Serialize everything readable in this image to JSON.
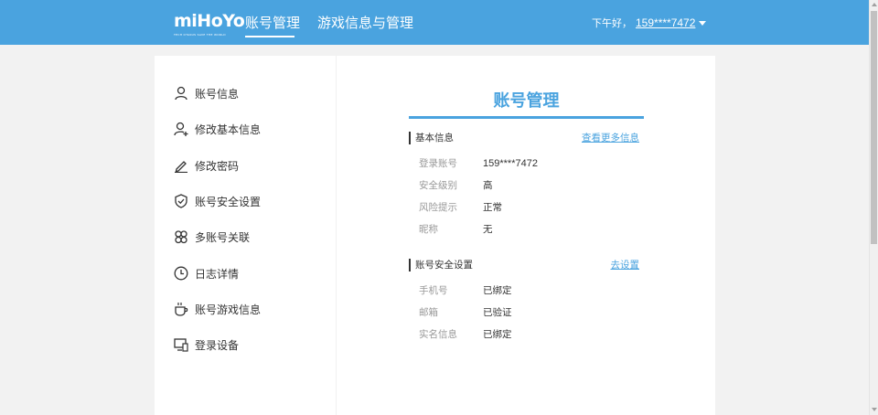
{
  "header": {
    "logo_text": "miHoYo",
    "logo_tagline": "TECH OTAKUS SAVE THE WORLD",
    "tabs": [
      {
        "label": "账号管理",
        "active": true
      },
      {
        "label": "游戏信息与管理",
        "active": false
      }
    ],
    "greeting": "下午好，",
    "username": "159****7472"
  },
  "sidebar": {
    "items": [
      {
        "label": "账号信息",
        "icon": "user-icon"
      },
      {
        "label": "修改基本信息",
        "icon": "user-edit-icon"
      },
      {
        "label": "修改密码",
        "icon": "pencil-icon"
      },
      {
        "label": "账号安全设置",
        "icon": "shield-check-icon"
      },
      {
        "label": "多账号关联",
        "icon": "multi-account-icon"
      },
      {
        "label": "日志详情",
        "icon": "clock-icon"
      },
      {
        "label": "账号游戏信息",
        "icon": "cup-icon"
      },
      {
        "label": "登录设备",
        "icon": "devices-icon"
      }
    ]
  },
  "main": {
    "title": "账号管理",
    "basic": {
      "title": "基本信息",
      "link": "查看更多信息",
      "rows": [
        {
          "label": "登录账号",
          "value": "159****7472"
        },
        {
          "label": "安全级别",
          "value": "高"
        },
        {
          "label": "风险提示",
          "value": "正常"
        },
        {
          "label": "昵称",
          "value": "无"
        }
      ]
    },
    "security": {
      "title": "账号安全设置",
      "link": "去设置",
      "rows": [
        {
          "label": "手机号",
          "value": "已绑定"
        },
        {
          "label": "邮箱",
          "value": "已验证"
        },
        {
          "label": "实名信息",
          "value": "已绑定"
        }
      ]
    }
  },
  "colors": {
    "brand_blue": "#4aa3df",
    "background": "#f2f2f2"
  }
}
